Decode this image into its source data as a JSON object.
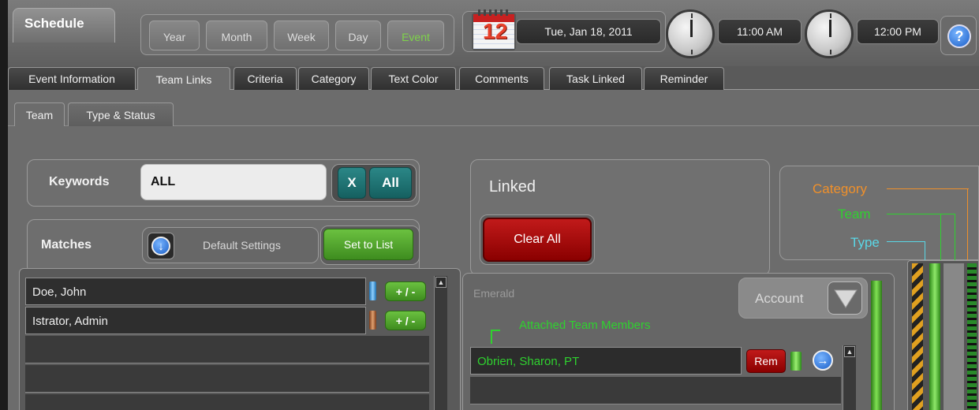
{
  "header": {
    "schedule_tab": "Schedule",
    "view_buttons": [
      "Year",
      "Month",
      "Week",
      "Day",
      "Event"
    ],
    "active_view": "Event",
    "calendar_icon_day": "12",
    "date": "Tue, Jan 18, 2011",
    "start_time": "11:00 AM",
    "end_time": "12:00 PM",
    "help_label": "?"
  },
  "tabs": [
    "Event Information",
    "Team Links",
    "Criteria",
    "Category",
    "Text Color",
    "Comments",
    "Task Linked",
    "Reminder"
  ],
  "active_tab": "Team Links",
  "subtabs": [
    "Team",
    "Type & Status"
  ],
  "active_subtab": "Team",
  "keywords": {
    "label": "Keywords",
    "value": "ALL",
    "clear_label": "X",
    "all_label": "All"
  },
  "matches": {
    "label": "Matches",
    "settings_label": "Default Settings",
    "set_to_list_label": "Set to List",
    "rows": [
      {
        "name": "Doe, John",
        "action": "+ / -",
        "chip_color": "#3a9ad9"
      },
      {
        "name": "Istrator, Admin",
        "action": "+ / -",
        "chip_color": "#b06a3a"
      }
    ]
  },
  "linked": {
    "title": "Linked",
    "clear_all_label": "Clear All",
    "group_name": "Emerald",
    "account_label": "Account",
    "attached_label": "Attached Team Members",
    "members": [
      {
        "name": "Obrien, Sharon, PT",
        "remove_label": "Rem"
      }
    ]
  },
  "legend": {
    "category": "Category",
    "team": "Team",
    "type": "Type"
  },
  "colors": {
    "accent_green": "#7ed34a",
    "legend_category": "#f0902a",
    "legend_team": "#2fd12f",
    "legend_type": "#5ad7e6",
    "clear_all_red": "#b01010",
    "keyword_teal": "#1f7575"
  },
  "icons": {
    "settings_icon": "down-arrow-circle-icon",
    "member_go_icon": "right-arrow-circle-icon",
    "account_filter_icon": "funnel-icon",
    "help_icon": "question-circle-icon"
  }
}
